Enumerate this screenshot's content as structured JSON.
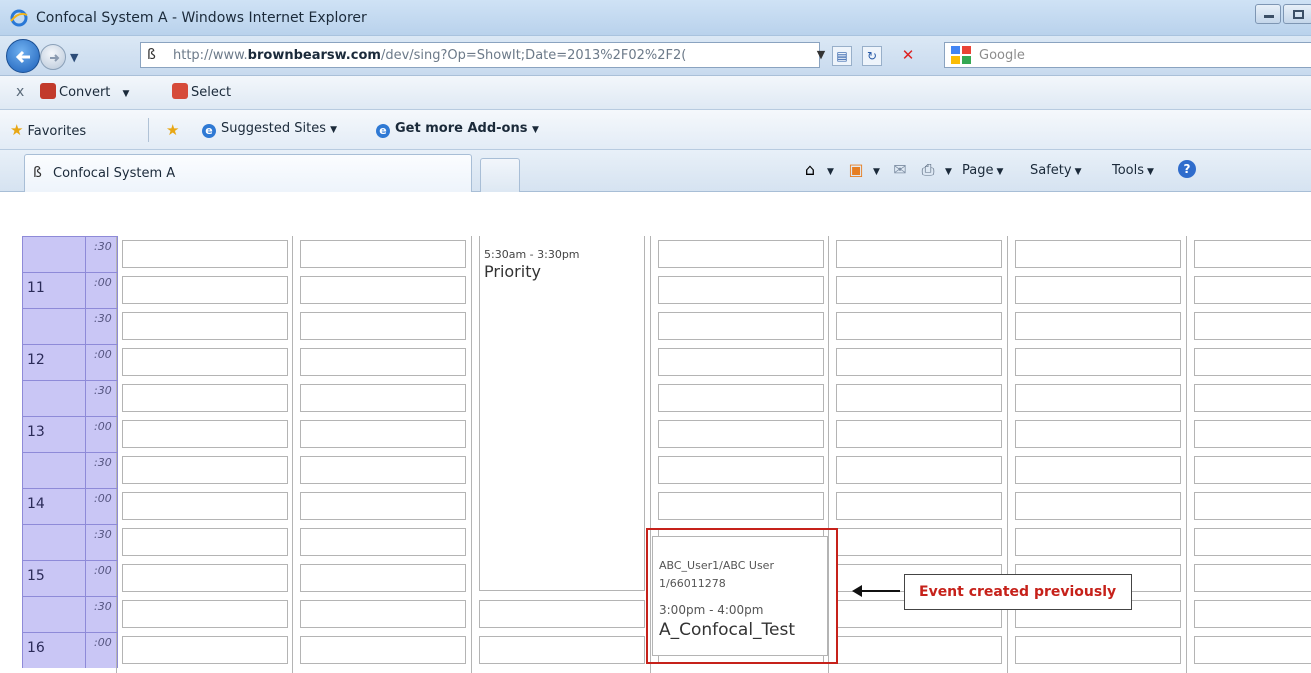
{
  "window": {
    "title": "Confocal System A - Windows Internet Explorer"
  },
  "navigation": {
    "url_prefix": "http://www.",
    "url_domain": "brownbearsw.com",
    "url_path": "/dev/sing?Op=ShowIt;Date=2013%2F02%2F2(",
    "search_placeholder": "Google"
  },
  "command_bar": {
    "close": "x",
    "convert": "Convert",
    "select": "Select"
  },
  "favorites_bar": {
    "favorites": "Favorites",
    "suggested_sites": "Suggested Sites",
    "addons": "Get more Add-ons"
  },
  "tabs": {
    "active_label": "Confocal System A"
  },
  "tools": {
    "page": "Page",
    "safety": "Safety",
    "tools": "Tools"
  },
  "calendar": {
    "rows": [
      {
        "hour": "",
        "minute": ":30"
      },
      {
        "hour": "11",
        "minute": ":00"
      },
      {
        "hour": "",
        "minute": ":30"
      },
      {
        "hour": "12",
        "minute": ":00"
      },
      {
        "hour": "",
        "minute": ":30"
      },
      {
        "hour": "13",
        "minute": ":00"
      },
      {
        "hour": "",
        "minute": ":30"
      },
      {
        "hour": "14",
        "minute": ":00"
      },
      {
        "hour": "",
        "minute": ":30"
      },
      {
        "hour": "15",
        "minute": ":00"
      },
      {
        "hour": "",
        "minute": ":30"
      },
      {
        "hour": "16",
        "minute": ":00"
      }
    ],
    "event_priority": {
      "time": "5:30am - 3:30pm",
      "title": "Priority"
    },
    "event_confocal": {
      "user": "ABC_User1/ABC User 1/66011278",
      "time": "3:00pm - 4:00pm",
      "title": "A_Confocal_Test"
    },
    "annotation": "Event created previously",
    "colors": {
      "hour_column": "#c9c6f5",
      "annotation_red": "#c6211a"
    }
  }
}
